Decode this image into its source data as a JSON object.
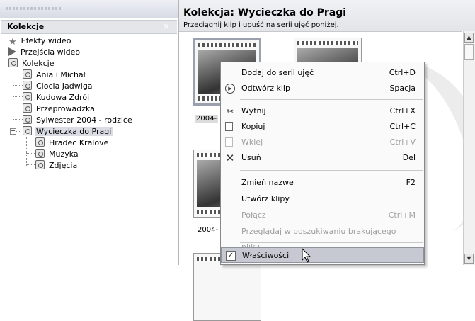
{
  "left_panel": {
    "title": "Kolekcje",
    "close_glyph": "×",
    "tree": [
      {
        "label": "Efekty wideo",
        "icon": "star-icon"
      },
      {
        "label": "Przejścia wideo",
        "icon": "transition-icon"
      },
      {
        "label": "Kolekcje",
        "icon": "collection-icon"
      },
      {
        "label": "Ania i Michał",
        "icon": "collection-icon"
      },
      {
        "label": "Ciocia Jadwiga",
        "icon": "collection-icon"
      },
      {
        "label": "Kudowa Zdrój",
        "icon": "collection-icon"
      },
      {
        "label": "Przeprowadzka",
        "icon": "collection-icon"
      },
      {
        "label": "Sylwester 2004 - rodzice",
        "icon": "collection-icon"
      },
      {
        "label": "Wycieczka do Pragi",
        "icon": "collection-icon",
        "selected": true
      },
      {
        "label": "Hradec Kralove",
        "icon": "collection-icon"
      },
      {
        "label": "Muzyka",
        "icon": "collection-icon"
      },
      {
        "label": "Zdjęcia",
        "icon": "collection-icon"
      }
    ]
  },
  "main": {
    "title": "Kolekcja: Wycieczka do Pragi",
    "subtitle": "Przeciągnij klip i upuść na serii ujęć poniżej.",
    "clip_captions": [
      "2004-",
      "2004-"
    ]
  },
  "context_menu": {
    "items": [
      {
        "label": "Dodaj do serii ujęć",
        "shortcut": "Ctrl+D",
        "icon": "",
        "enabled": true
      },
      {
        "label": "Odtwórz klip",
        "shortcut": "Spacja",
        "icon": "play-icon",
        "enabled": true
      },
      {
        "label": "Wytnij",
        "shortcut": "Ctrl+X",
        "icon": "scissors-icon",
        "enabled": true
      },
      {
        "label": "Kopiuj",
        "shortcut": "Ctrl+C",
        "icon": "copy-icon",
        "enabled": true
      },
      {
        "label": "Wklej",
        "shortcut": "Ctrl+V",
        "icon": "paste-icon",
        "enabled": false
      },
      {
        "label": "Usuń",
        "shortcut": "Del",
        "icon": "delete-icon",
        "enabled": true
      },
      {
        "label": "Zmień nazwę",
        "shortcut": "F2",
        "icon": "",
        "enabled": true
      },
      {
        "label": "Utwórz klipy",
        "shortcut": "",
        "icon": "",
        "enabled": true
      },
      {
        "label": "Połącz",
        "shortcut": "Ctrl+M",
        "icon": "",
        "enabled": false
      },
      {
        "label": "Przeglądaj w poszukiwaniu brakującego pliku...",
        "shortcut": "",
        "icon": "",
        "enabled": false
      },
      {
        "label": "Właściwości",
        "shortcut": "",
        "icon": "properties-icon",
        "enabled": true,
        "highlighted": true
      }
    ]
  }
}
